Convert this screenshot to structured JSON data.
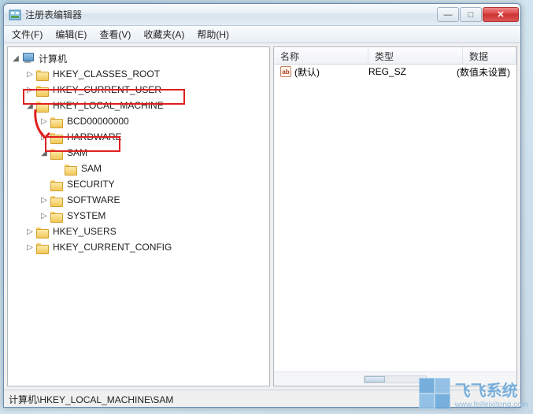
{
  "window": {
    "title": "注册表编辑器"
  },
  "menu": {
    "file": "文件(F)",
    "edit": "编辑(E)",
    "view": "查看(V)",
    "favorites": "收藏夹(A)",
    "help": "帮助(H)"
  },
  "tree": {
    "root": "计算机",
    "hkcr": "HKEY_CLASSES_ROOT",
    "hkcu": "HKEY_CURRENT_USER",
    "hklm": "HKEY_LOCAL_MACHINE",
    "bcd": "BCD00000000",
    "hardware": "HARDWARE",
    "sam": "SAM",
    "sam_child": "SAM",
    "security": "SECURITY",
    "software": "SOFTWARE",
    "system": "SYSTEM",
    "hku": "HKEY_USERS",
    "hkcc": "HKEY_CURRENT_CONFIG"
  },
  "list": {
    "headers": {
      "name": "名称",
      "type": "类型",
      "data": "数据"
    },
    "rows": [
      {
        "icon": "ab",
        "name": "(默认)",
        "type": "REG_SZ",
        "data": "(数值未设置)"
      }
    ]
  },
  "status": {
    "path": "计算机\\HKEY_LOCAL_MACHINE\\SAM"
  },
  "watermark": {
    "text": "飞飞系统",
    "url": "www.feifeixitong.com"
  },
  "winbtns": {
    "min": "—",
    "max": "□",
    "close": "✕"
  },
  "toggles": {
    "open": "◢",
    "closed": "▷"
  }
}
